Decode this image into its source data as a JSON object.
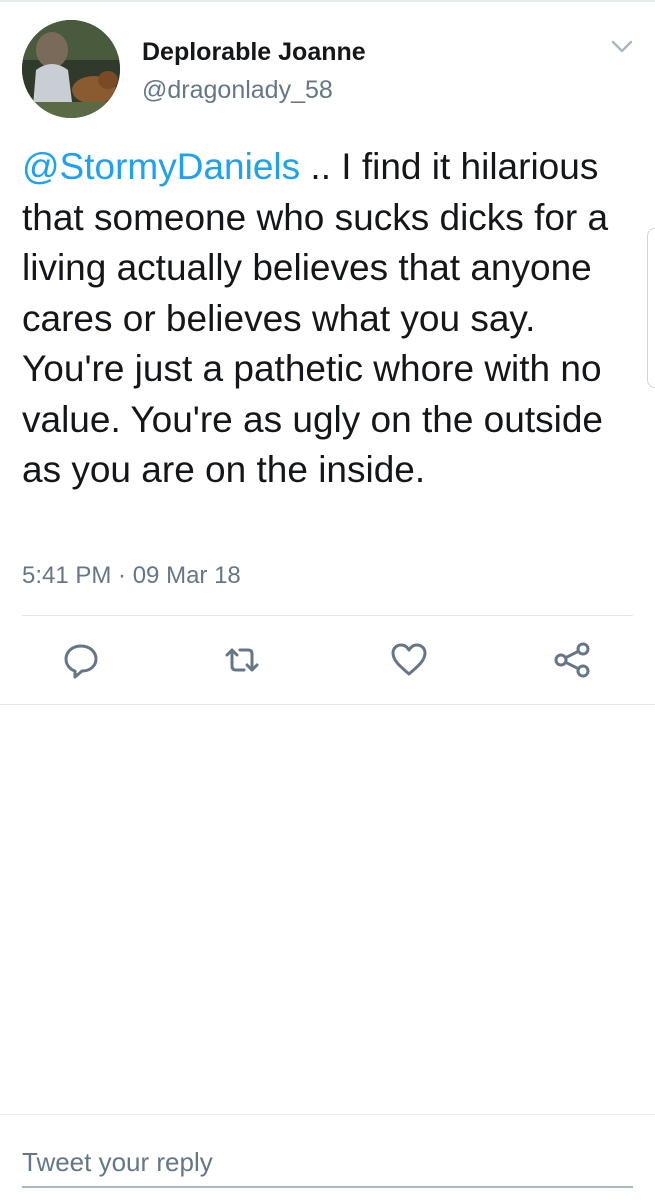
{
  "tweet": {
    "author_name": "Deplorable Joanne",
    "author_handle": "@dragonlady_58",
    "mention": "@StormyDaniels",
    "body": " .. I find it hilarious that someone who sucks dicks for a living actually believes that anyone cares or believes what you say. You're just a pathetic whore with no value. You're as ugly on the outside as you are on the inside.",
    "timestamp": "5:41 PM · 09 Mar 18"
  },
  "actions": {
    "icons": [
      "reply-icon",
      "retweet-icon",
      "like-icon",
      "share-icon"
    ]
  },
  "reply": {
    "placeholder": "Tweet your reply"
  },
  "colors": {
    "link": "#1da1f2",
    "secondary_text": "#657786",
    "primary_text": "#14171a"
  }
}
